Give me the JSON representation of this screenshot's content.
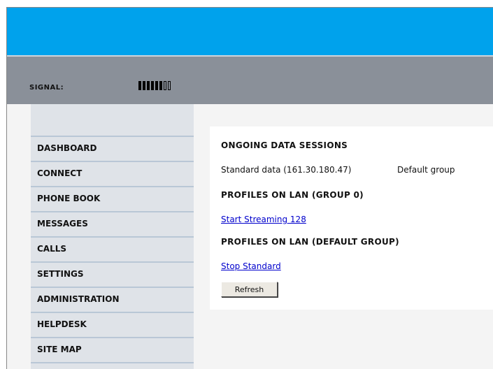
{
  "header": {
    "signal_label": "SIGNAL:",
    "signal_strength": {
      "filled": 6,
      "total": 8
    }
  },
  "sidebar": {
    "items": [
      {
        "label": "DASHBOARD"
      },
      {
        "label": "CONNECT"
      },
      {
        "label": "PHONE BOOK"
      },
      {
        "label": "MESSAGES"
      },
      {
        "label": "CALLS"
      },
      {
        "label": "SETTINGS"
      },
      {
        "label": "ADMINISTRATION"
      },
      {
        "label": "HELPDESK"
      },
      {
        "label": "SITE MAP"
      }
    ]
  },
  "main": {
    "ongoing_heading": "ONGOING DATA SESSIONS",
    "session": {
      "name": "Standard data (161.30.180.47)",
      "group": "Default group"
    },
    "group0_heading": "PROFILES ON LAN (GROUP 0)",
    "group0_link": "Start Streaming 128",
    "default_heading": "PROFILES ON LAN (DEFAULT GROUP)",
    "default_link": "Stop Standard",
    "refresh_label": "Refresh"
  },
  "colors": {
    "top_bar": "#00a2ec",
    "signal_bar": "#8a9099",
    "sidebar_bg": "#dfe3e8",
    "sidebar_divider": "#b9c7d6",
    "link": "#0000cc"
  }
}
